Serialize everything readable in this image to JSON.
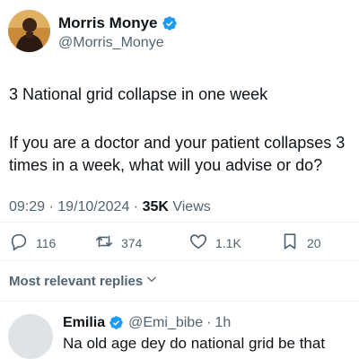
{
  "author": {
    "name": "Morris Monye",
    "handle": "@Morris_Monye"
  },
  "tweet": {
    "line1": "3 National grid collapse in one week",
    "line2": "If you are a doctor and your patient collapses 3",
    "line3": "times in a week, what will you advise or do?"
  },
  "meta": {
    "time": "09:29",
    "sep1": " · ",
    "date": "19/10/2024",
    "sep2": " · ",
    "views_count": "35K",
    "views_label": " Views"
  },
  "actions": {
    "replies": "116",
    "reposts": "374",
    "likes": "1.1K",
    "bookmarks": "20"
  },
  "replies_filter": "Most relevant replies",
  "reply": {
    "name": "Emilia",
    "handle": "@Emi_bibe",
    "sep": " · ",
    "time": "1h",
    "text": "Na old age dey do national grid be that"
  },
  "colors": {
    "verified": "#1d9bf0",
    "muted": "#536471",
    "text": "#0f1419"
  },
  "icons": [
    "verified-badge-icon",
    "reply-icon",
    "repost-icon",
    "like-icon",
    "bookmark-icon",
    "chevron-down-icon"
  ]
}
